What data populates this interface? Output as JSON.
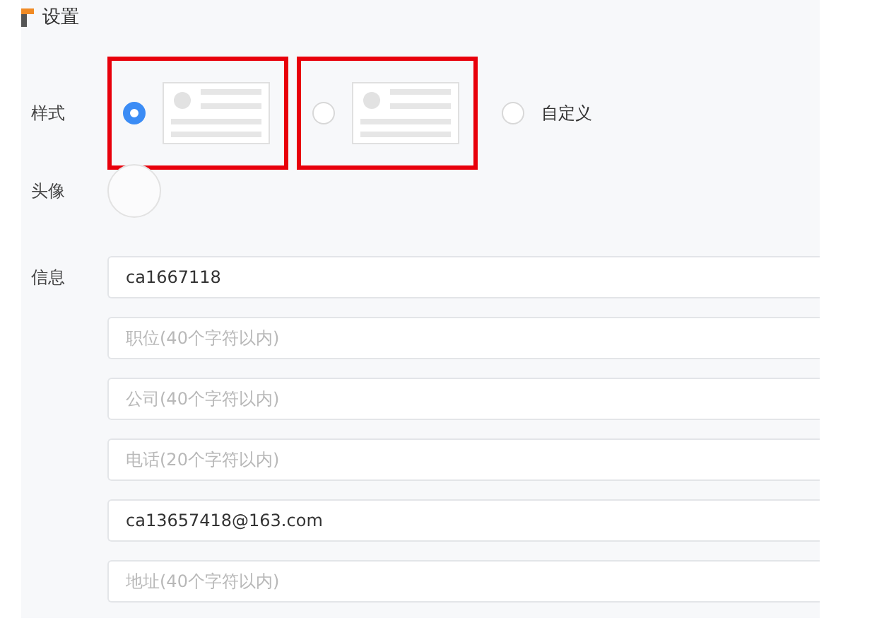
{
  "header": {
    "title": "设置"
  },
  "style_row": {
    "label": "样式",
    "options": [
      {
        "kind": "card",
        "selected": true,
        "highlighted": true
      },
      {
        "kind": "card",
        "selected": false,
        "highlighted": true
      },
      {
        "kind": "text",
        "label": "自定义",
        "selected": false,
        "highlighted": false
      }
    ]
  },
  "avatar_row": {
    "label": "头像"
  },
  "info_row": {
    "label": "信息",
    "fields": [
      {
        "value": "ca1667118"
      },
      {
        "placeholder": "职位(40个字符以内)"
      },
      {
        "placeholder": "公司(40个字符以内)"
      },
      {
        "placeholder": "电话(20个字符以内)"
      },
      {
        "value": "ca13657418@163.com"
      },
      {
        "placeholder": "地址(40个字符以内)"
      }
    ]
  }
}
